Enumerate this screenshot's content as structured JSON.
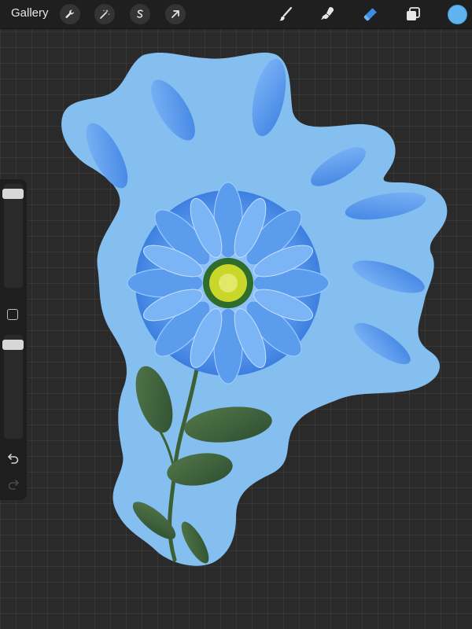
{
  "topbar": {
    "gallery_label": "Gallery",
    "actions": [
      {
        "name": "actions-wrench",
        "icon": "wrench-icon"
      },
      {
        "name": "adjustments",
        "icon": "magic-wand-icon"
      },
      {
        "name": "selection",
        "icon": "selection-s-icon"
      },
      {
        "name": "transform",
        "icon": "arrow-cursor-icon"
      }
    ],
    "tools": [
      {
        "name": "brush",
        "icon": "brush-icon"
      },
      {
        "name": "smudge",
        "icon": "smudge-icon"
      },
      {
        "name": "eraser",
        "icon": "eraser-icon",
        "active": true
      },
      {
        "name": "layers",
        "icon": "layers-icon"
      }
    ],
    "current_color": "#5fb3ee"
  },
  "sidebar": {
    "brush_size_level": 0.95,
    "opacity_level": 1.0,
    "undo_icon": "undo-icon",
    "redo_icon": "redo-icon",
    "modify_icon": "square-icon"
  },
  "colors": {
    "canvas_bg": "#2a2a2a",
    "cutout_bg": "#85bff0",
    "accent_blue": "#4a90e2",
    "flower_center": "#c9d62a"
  }
}
